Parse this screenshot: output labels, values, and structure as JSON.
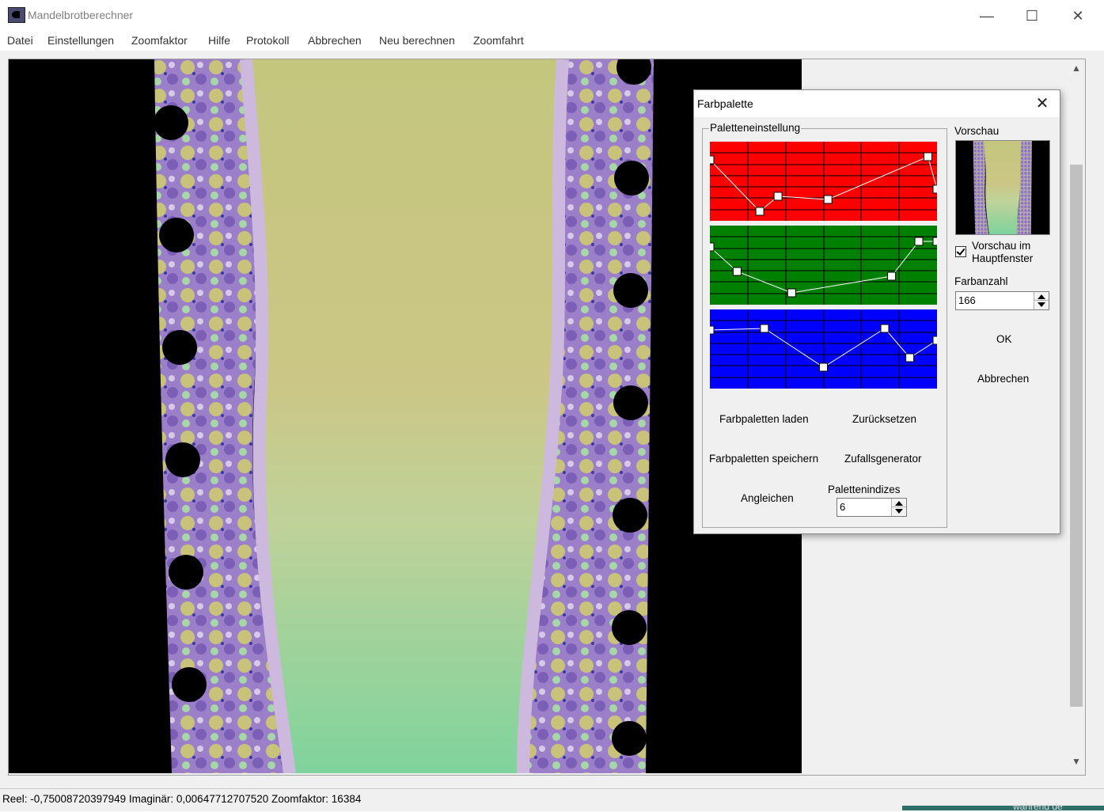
{
  "window": {
    "title": "Mandelbrotberechner",
    "controls": {
      "minimize": "—",
      "maximize": "☐",
      "close": "✕"
    }
  },
  "menu": [
    "Datei",
    "Einstellungen",
    "Zoomfaktor",
    "Hilfe",
    "Protokoll",
    "Abbrechen",
    "Neu berechnen",
    "Zoomfahrt"
  ],
  "status": "Reel: -0,75008720397949 Imaginär: 0,00647712707520 Zoomfaktor: 16384",
  "scroll": {
    "up": "▲",
    "down": "▼"
  },
  "desktop_text": "wahrend de",
  "dialog": {
    "title": "Farbpalette",
    "close": "✕",
    "group_label": "Paletteneinstellung",
    "channels": {
      "red": {
        "color": "#ff0000",
        "points": [
          [
            0,
            0.23
          ],
          [
            0.22,
            0.88
          ],
          [
            0.3,
            0.69
          ],
          [
            0.52,
            0.73
          ],
          [
            0.96,
            0.19
          ],
          [
            1,
            0.6
          ]
        ]
      },
      "green": {
        "color": "#008000",
        "points": [
          [
            0,
            0.27
          ],
          [
            0.12,
            0.58
          ],
          [
            0.36,
            0.85
          ],
          [
            0.8,
            0.64
          ],
          [
            0.92,
            0.2
          ],
          [
            1,
            0.2
          ]
        ]
      },
      "blue": {
        "color": "#0000ff",
        "points": [
          [
            0,
            0.26
          ],
          [
            0.24,
            0.24
          ],
          [
            0.5,
            0.73
          ],
          [
            0.77,
            0.24
          ],
          [
            0.88,
            0.61
          ],
          [
            1,
            0.39
          ]
        ]
      }
    },
    "buttons": {
      "load": "Farbpaletten laden",
      "reset": "Zurücksetzen",
      "save": "Farbpaletten speichern",
      "random": "Zufallsgenerator",
      "equalize": "Angleichen",
      "ok": "OK",
      "cancel": "Abbrechen"
    },
    "palette_indices": {
      "label": "Palettenindizes",
      "value": "6"
    },
    "preview": {
      "label": "Vorschau",
      "checkbox_label": "Vorschau im Hauptfenster",
      "checked": true
    },
    "color_count": {
      "label": "Farbanzahl",
      "value": "166"
    }
  },
  "fractal_colors": {
    "background": "#000000",
    "inner": "#c9c47e",
    "green": "#86d3a0",
    "purple": "#9a7cc6",
    "lavender": "#c8b6d9"
  }
}
